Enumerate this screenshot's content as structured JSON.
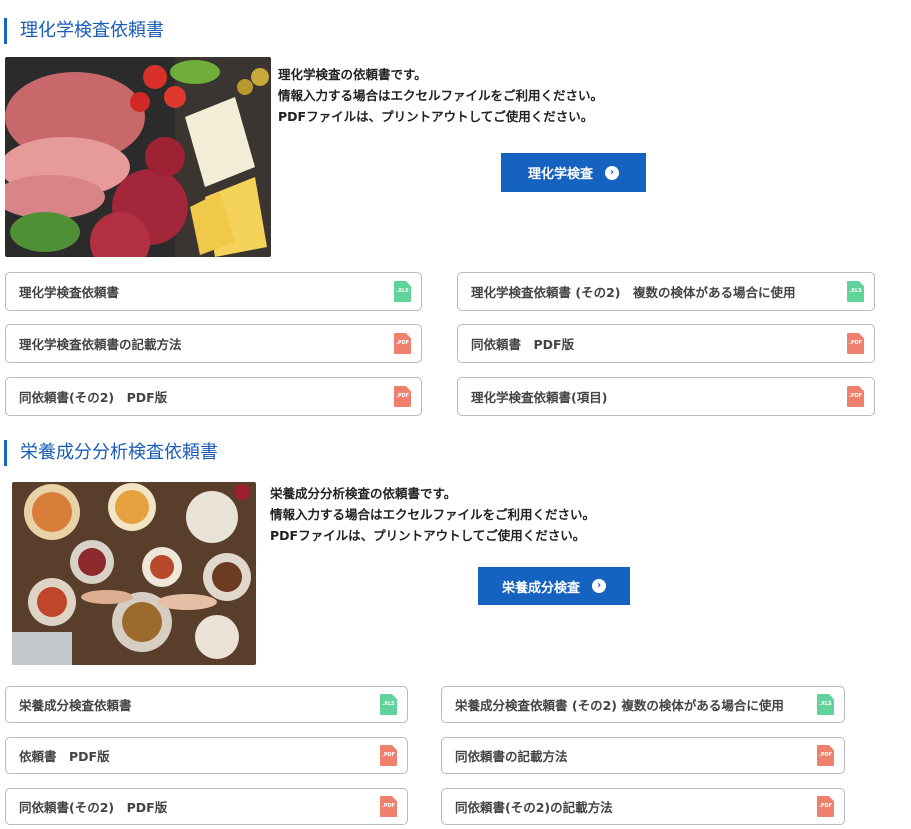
{
  "sections": [
    {
      "title": "理化学検査依頼書",
      "intro": [
        "理化学検査の依頼書です。",
        "情報入力する場合はエクセルファイルをご利用ください。",
        "PDFファイルは、プリントアウトしてご使用ください。"
      ],
      "button_label": "理化学検査",
      "downloads": [
        {
          "label": "理化学検査依頼書",
          "type": "xls",
          "type_label": ".XLS"
        },
        {
          "label": "理化学検査依頼書 (その2)　複数の検体がある場合に使用",
          "type": "xls",
          "type_label": ".XLS"
        },
        {
          "label": "理化学検査依頼書の記載方法",
          "type": "pdf",
          "type_label": ".PDF"
        },
        {
          "label": "同依頼書　PDF版",
          "type": "pdf",
          "type_label": ".PDF"
        },
        {
          "label": "同依頼書(その2)　PDF版",
          "type": "pdf",
          "type_label": ".PDF"
        },
        {
          "label": "理化学検査依頼書(項目)",
          "type": "pdf",
          "type_label": ".PDF"
        }
      ]
    },
    {
      "title": "栄養成分分析検査依頼書",
      "intro": [
        "栄養成分分析検査の依頼書です。",
        "情報入力する場合はエクセルファイルをご利用ください。",
        "PDFファイルは、プリントアウトしてご使用ください。"
      ],
      "button_label": "栄養成分検査",
      "downloads": [
        {
          "label": "栄養成分検査依頼書",
          "type": "xls",
          "type_label": ".XLS"
        },
        {
          "label": "栄養成分検査依頼書 (その2) 複数の検体がある場合に使用",
          "type": "xls",
          "type_label": ".XLS"
        },
        {
          "label": "依頼書　PDF版",
          "type": "pdf",
          "type_label": ".PDF"
        },
        {
          "label": "同依頼書の記載方法",
          "type": "pdf",
          "type_label": ".PDF"
        },
        {
          "label": "同依頼書(その2)　PDF版",
          "type": "pdf",
          "type_label": ".PDF"
        },
        {
          "label": "同依頼書(その2)の記載方法",
          "type": "pdf",
          "type_label": ".PDF"
        }
      ]
    }
  ],
  "colors": {
    "accent": "#1562c0",
    "title_text": "#1a5cb8",
    "xls_icon": "#5fd39a",
    "pdf_icon": "#f0806e",
    "border": "#b9b9b9"
  },
  "icons": {
    "cta_arrow": "chevron-right-circle-icon",
    "xls": "xls-file-icon",
    "pdf": "pdf-file-icon"
  }
}
